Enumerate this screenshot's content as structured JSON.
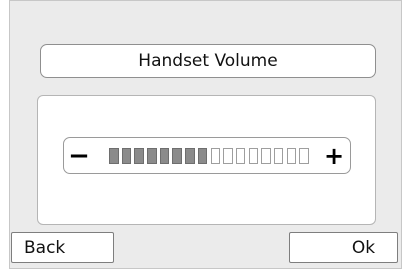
{
  "header": {
    "title": "Handset Volume"
  },
  "volume": {
    "minus_label": "−",
    "plus_label": "+",
    "level": 8,
    "max": 16
  },
  "footer": {
    "back_label": "Back",
    "ok_label": "Ok"
  },
  "colors": {
    "panel_bg": "#ebebeb",
    "segment_on": "#8b8b8b",
    "segment_off": "#ffffff"
  }
}
